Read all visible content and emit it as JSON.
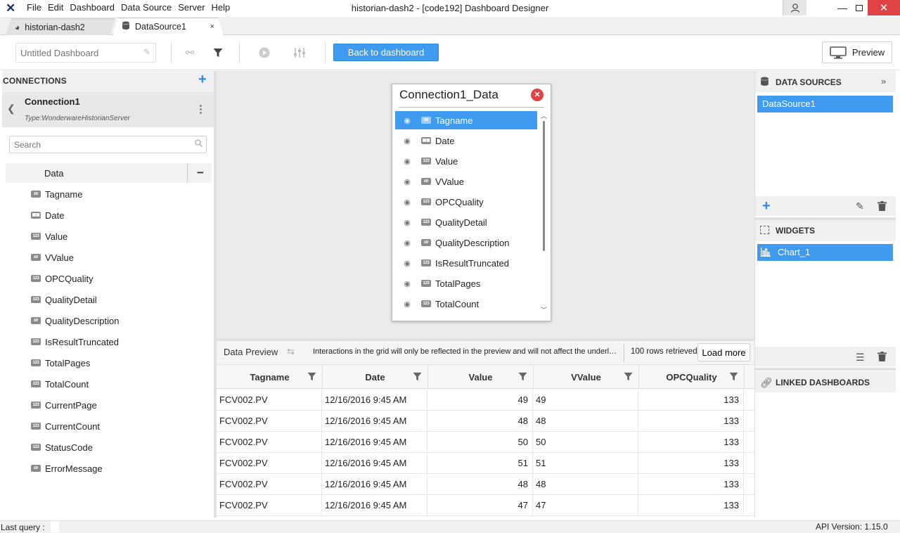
{
  "app": {
    "window_title": "historian-dash2 - [code192] Dashboard Designer",
    "menu": [
      "File",
      "Edit",
      "Dashboard",
      "Data Source",
      "Server",
      "Help"
    ]
  },
  "tabs": [
    {
      "label": "historian-dash2"
    },
    {
      "label": "DataSource1",
      "close": "×"
    }
  ],
  "toolbar": {
    "dashboard_name_placeholder": "Untitled Dashboard",
    "back_label": "Back to dashboard",
    "preview_label": "Preview"
  },
  "connections": {
    "title": "CONNECTIONS",
    "add": "+",
    "connection": {
      "name": "Connection1",
      "type": "Type:WonderwareHistorianServer"
    },
    "search_placeholder": "Search",
    "data_node": "Data",
    "collapse": "−",
    "fields": [
      {
        "type": "str",
        "name": "Tagname"
      },
      {
        "type": "cal",
        "name": "Date"
      },
      {
        "type": "123",
        "name": "Value"
      },
      {
        "type": "str",
        "name": "VValue"
      },
      {
        "type": "123",
        "name": "OPCQuality"
      },
      {
        "type": "123",
        "name": "QualityDetail"
      },
      {
        "type": "str",
        "name": "QualityDescription"
      },
      {
        "type": "123",
        "name": "IsResultTruncated"
      },
      {
        "type": "123",
        "name": "TotalPages"
      },
      {
        "type": "123",
        "name": "TotalCount"
      },
      {
        "type": "123",
        "name": "CurrentPage"
      },
      {
        "type": "123",
        "name": "CurrentCount"
      },
      {
        "type": "123",
        "name": "StatusCode"
      },
      {
        "type": "str",
        "name": "ErrorMessage"
      }
    ]
  },
  "popup": {
    "title": "Connection1_Data",
    "fields": [
      {
        "type": "str",
        "name": "Tagname",
        "selected": true
      },
      {
        "type": "cal",
        "name": "Date"
      },
      {
        "type": "123",
        "name": "Value"
      },
      {
        "type": "str",
        "name": "VValue"
      },
      {
        "type": "123",
        "name": "OPCQuality"
      },
      {
        "type": "123",
        "name": "QualityDetail"
      },
      {
        "type": "str",
        "name": "QualityDescription"
      },
      {
        "type": "123",
        "name": "IsResultTruncated"
      },
      {
        "type": "123",
        "name": "TotalPages"
      },
      {
        "type": "123",
        "name": "TotalCount"
      }
    ]
  },
  "preview": {
    "title": "Data Preview",
    "message": "Interactions in the grid will only be reflected in the preview and will not affect the underlying data source.",
    "rows_retrieved": "100 rows retrieved",
    "load_more": "Load more",
    "columns": [
      "Tagname",
      "Date",
      "Value",
      "VValue",
      "OPCQuality"
    ],
    "rows": [
      [
        "FCV002.PV",
        "12/16/2016 9:45 AM",
        "49",
        "49",
        "133"
      ],
      [
        "FCV002.PV",
        "12/16/2016 9:45 AM",
        "48",
        "48",
        "133"
      ],
      [
        "FCV002.PV",
        "12/16/2016 9:45 AM",
        "50",
        "50",
        "133"
      ],
      [
        "FCV002.PV",
        "12/16/2016 9:45 AM",
        "51",
        "51",
        "133"
      ],
      [
        "FCV002.PV",
        "12/16/2016 9:45 AM",
        "48",
        "48",
        "133"
      ],
      [
        "FCV002.PV",
        "12/16/2016 9:45 AM",
        "47",
        "47",
        "133"
      ]
    ]
  },
  "right": {
    "data_sources_title": "DATA SOURCES",
    "data_sources": [
      "DataSource1"
    ],
    "widgets_title": "WIDGETS",
    "widgets": [
      "Chart_1"
    ],
    "linked_title": "LINKED DASHBOARDS"
  },
  "status": {
    "last_query": "Last query :",
    "api_version": "API Version: 1.15.0"
  }
}
